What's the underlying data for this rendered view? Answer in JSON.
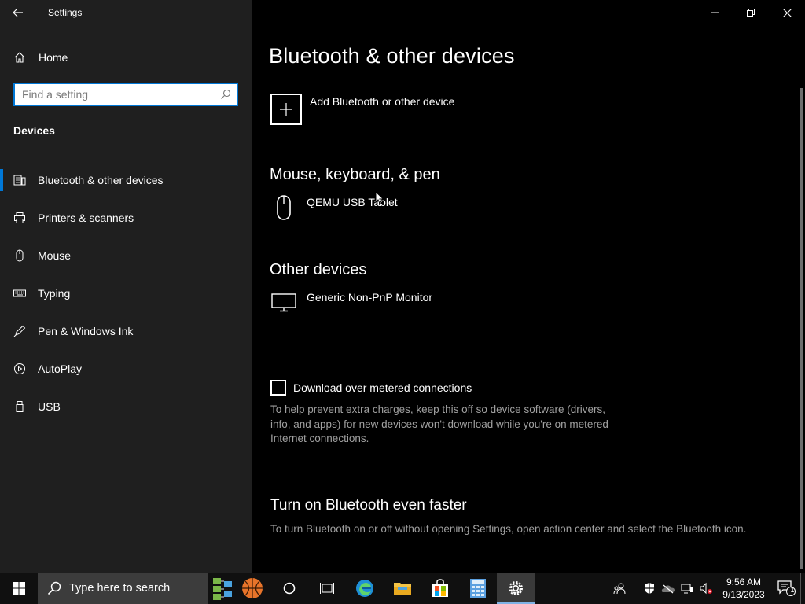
{
  "window": {
    "title": "Settings",
    "controls": {
      "minimize": "minimize",
      "restore": "restore",
      "close": "close"
    }
  },
  "sidebar": {
    "home_label": "Home",
    "search_placeholder": "Find a setting",
    "section_title": "Devices",
    "items": [
      {
        "label": "Bluetooth & other devices",
        "icon": "bluetooth-devices-icon",
        "active": true
      },
      {
        "label": "Printers & scanners",
        "icon": "printer-icon",
        "active": false
      },
      {
        "label": "Mouse",
        "icon": "mouse-icon",
        "active": false
      },
      {
        "label": "Typing",
        "icon": "keyboard-icon",
        "active": false
      },
      {
        "label": "Pen & Windows Ink",
        "icon": "pen-icon",
        "active": false
      },
      {
        "label": "AutoPlay",
        "icon": "autoplay-icon",
        "active": false
      },
      {
        "label": "USB",
        "icon": "usb-icon",
        "active": false
      }
    ]
  },
  "main": {
    "title": "Bluetooth & other devices",
    "add_device_label": "Add Bluetooth or other device",
    "mouse_section": {
      "heading": "Mouse, keyboard, & pen",
      "devices": [
        {
          "name": "QEMU USB Tablet",
          "icon": "mouse-icon"
        }
      ]
    },
    "other_section": {
      "heading": "Other devices",
      "devices": [
        {
          "name": "Generic Non-PnP Monitor",
          "icon": "monitor-icon"
        }
      ]
    },
    "metered": {
      "label": "Download over metered connections",
      "checked": false,
      "help": "To help prevent extra charges, keep this off so device software (drivers, info, and apps) for new devices won't download while you're on metered Internet connections."
    },
    "bluetooth_faster": {
      "heading": "Turn on Bluetooth even faster",
      "help": "To turn Bluetooth on or off without opening Settings, open action center and select the Bluetooth icon."
    }
  },
  "taskbar": {
    "search_text": "Type here to search",
    "apps": [
      "cortana-icon",
      "task-view-icon",
      "edge-icon",
      "file-explorer-icon",
      "store-icon",
      "calculator-icon",
      "settings-icon"
    ],
    "active_app": "settings-icon",
    "clock_time": "9:56 AM",
    "clock_date": "9/13/2023",
    "notification_count": "1"
  },
  "colors": {
    "accent": "#0078d7",
    "sidebar_bg": "#1f1f1f",
    "content_bg": "#000000",
    "secondary_text": "#a0a0a0"
  }
}
